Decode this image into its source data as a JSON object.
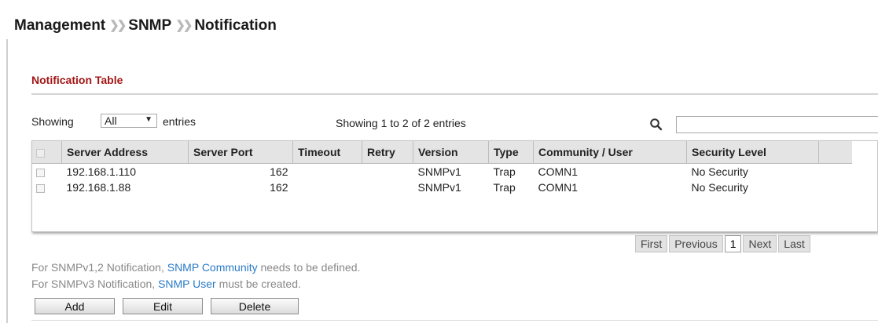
{
  "breadcrumb": [
    "Management",
    "SNMP",
    "Notification"
  ],
  "section": {
    "title": "Notification Table"
  },
  "controls": {
    "showing_label": "Showing",
    "entries_select": "All",
    "entries_label": "entries",
    "info": "Showing 1 to 2 of 2 entries",
    "search_placeholder": ""
  },
  "table": {
    "columns": [
      "Server Address",
      "Server Port",
      "Timeout",
      "Retry",
      "Version",
      "Type",
      "Community / User",
      "Security Level"
    ],
    "rows": [
      {
        "address": "192.168.1.110",
        "port": "162",
        "timeout": "",
        "retry": "",
        "version": "SNMPv1",
        "type": "Trap",
        "community": "COMN1",
        "security": "No Security"
      },
      {
        "address": "192.168.1.88",
        "port": "162",
        "timeout": "",
        "retry": "",
        "version": "SNMPv1",
        "type": "Trap",
        "community": "COMN1",
        "security": "No Security"
      }
    ]
  },
  "pagination": {
    "first": "First",
    "previous": "Previous",
    "current": "1",
    "next": "Next",
    "last": "Last"
  },
  "notes": {
    "line1_pre": "For SNMPv1,2 Notification, ",
    "line1_link": "SNMP Community",
    "line1_post": " needs to be defined.",
    "line2_pre": "For SNMPv3 Notification, ",
    "line2_link": "SNMP User",
    "line2_post": " must be created."
  },
  "buttons": {
    "add": "Add",
    "edit": "Edit",
    "delete": "Delete"
  },
  "colors": {
    "section_title": "#a31515",
    "link": "#2a7ac5",
    "header_bg": "#e4e4e4"
  }
}
